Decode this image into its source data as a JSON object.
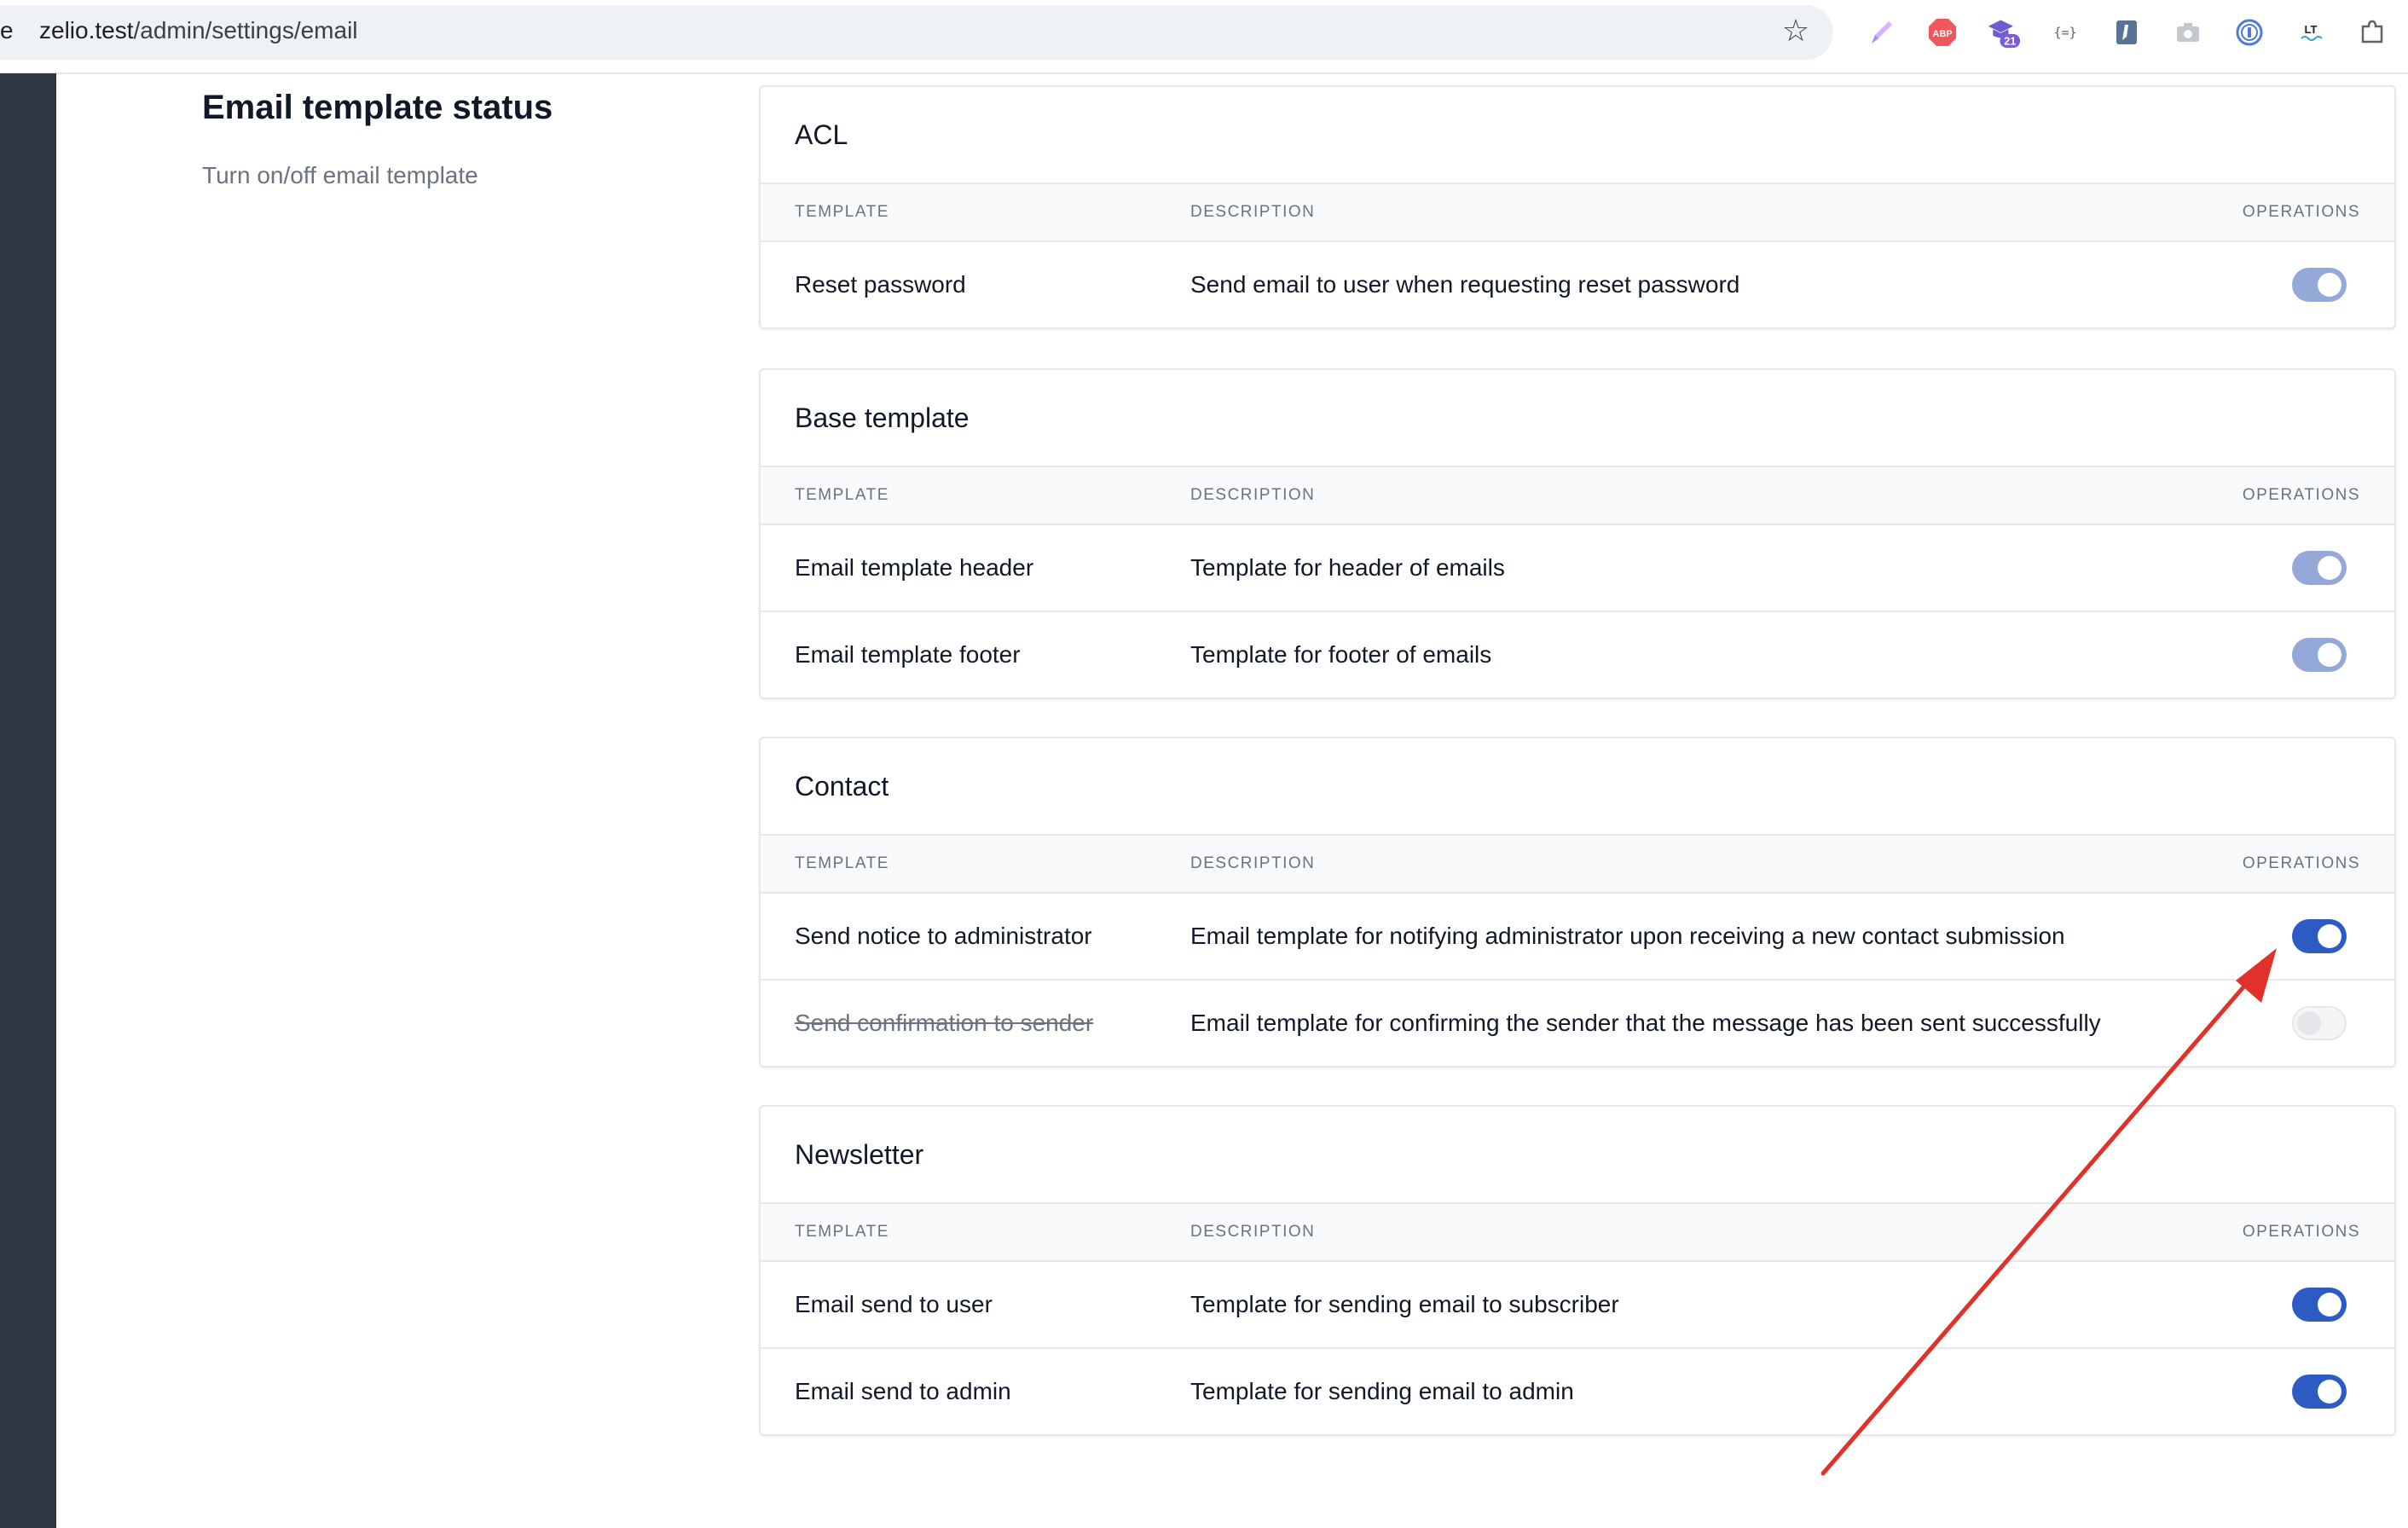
{
  "browser": {
    "edge_char": "e",
    "url_host": "zelio.test",
    "url_path": "/admin/settings/email",
    "extension_badge": "21"
  },
  "section": {
    "title": "Email template status",
    "subtitle": "Turn on/off email template"
  },
  "table_headers": {
    "template": "TEMPLATE",
    "description": "DESCRIPTION",
    "operations": "OPERATIONS"
  },
  "cards": [
    {
      "title": "ACL",
      "rows": [
        {
          "template": "Reset password",
          "description": "Send email to user when requesting reset password",
          "enabled": true,
          "disabled_control": true
        }
      ]
    },
    {
      "title": "Base template",
      "rows": [
        {
          "template": "Email template header",
          "description": "Template for header of emails",
          "enabled": true,
          "disabled_control": true
        },
        {
          "template": "Email template footer",
          "description": "Template for footer of emails",
          "enabled": true,
          "disabled_control": true
        }
      ]
    },
    {
      "title": "Contact",
      "rows": [
        {
          "template": "Send notice to administrator",
          "description": "Email template for notifying administrator upon receiving a new contact submission",
          "enabled": true,
          "disabled_control": false
        },
        {
          "template": "Send confirmation to sender",
          "description": "Email template for confirming the sender that the message has been sent successfully",
          "enabled": false,
          "disabled_control": false
        }
      ]
    },
    {
      "title": "Newsletter",
      "rows": [
        {
          "template": "Email send to user",
          "description": "Template for sending email to subscriber",
          "enabled": true,
          "disabled_control": false
        },
        {
          "template": "Email send to admin",
          "description": "Template for sending email to admin",
          "enabled": true,
          "disabled_control": false
        }
      ]
    }
  ],
  "colors": {
    "toggle_on": "#2c5bc4",
    "toggle_on_locked": "#94a9d8",
    "annotation_arrow": "#e0312b",
    "sidebar": "#303643"
  }
}
